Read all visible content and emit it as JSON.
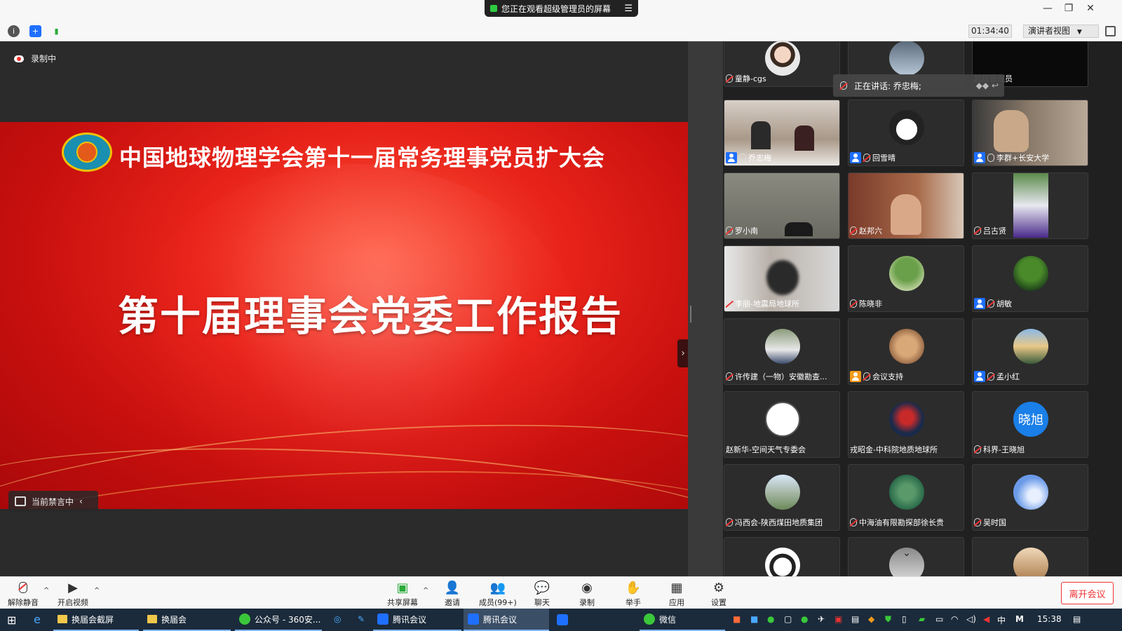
{
  "banner": {
    "text": "您正在观看超级管理员的屏幕",
    "menu_icon": "menu-icon"
  },
  "window_controls": [
    "minimize-icon",
    "restore-icon",
    "close-icon"
  ],
  "toolbar": {
    "icons": [
      "info-icon",
      "shield-icon",
      "signal-icon"
    ],
    "timer": "01:34:40",
    "view_mode": "演讲者视图",
    "fullscreen_icon": "fullscreen-icon"
  },
  "stage": {
    "recording_label": "录制中",
    "slide_title": "中国地球物理学会第十一届常务理事党员扩大会",
    "slide_main": "第十届理事会党委工作报告",
    "mute_status": "当前禁言中"
  },
  "speaking": {
    "text": "正在讲话: 乔忠梅;"
  },
  "participants": [
    {
      "name": "童静-cgs",
      "avatar": "child-photo",
      "host": false,
      "mic": "muted"
    },
    {
      "name": "",
      "avatar": "people-photo",
      "host": false,
      "mic": "none"
    },
    {
      "name": "超级管理员",
      "avatar": "dark-screen",
      "host": false,
      "mic": "none"
    },
    {
      "name": "乔忠梅",
      "avatar": "meeting-room-video",
      "host": true,
      "mic": "on"
    },
    {
      "name": "回雪晴",
      "avatar": "penguin-avatar",
      "host": true,
      "mic": "muted"
    },
    {
      "name": "李群+长安大学",
      "avatar": "man-video",
      "host": true,
      "mic": "on"
    },
    {
      "name": "罗小南",
      "avatar": "room-video",
      "host": false,
      "mic": "muted"
    },
    {
      "name": "赵邦六",
      "avatar": "office-video",
      "host": false,
      "mic": "muted"
    },
    {
      "name": "吕古贤",
      "avatar": "garden-video",
      "host": false,
      "mic": "muted"
    },
    {
      "name": "李丽-地震局地球所",
      "avatar": "blurred-video",
      "host": false,
      "mic": "muted"
    },
    {
      "name": "陈晓非",
      "avatar": "tree-photo",
      "host": false,
      "mic": "muted"
    },
    {
      "name": "胡敏",
      "avatar": "tree-photo-2",
      "host": true,
      "mic": "muted"
    },
    {
      "name": "许传建（一物）安徽勘查...",
      "avatar": "man-photo",
      "host": false,
      "mic": "muted"
    },
    {
      "name": "会议支持",
      "avatar": "dog-photo",
      "host": true,
      "mic": "muted",
      "badge": "orange"
    },
    {
      "name": "孟小红",
      "avatar": "lake-photo",
      "host": true,
      "mic": "muted"
    },
    {
      "name": "赵新华-空间天气专委会",
      "avatar": "tree-drawing",
      "host": false,
      "mic": "none"
    },
    {
      "name": "戎昭金-中科院地质地球所",
      "avatar": "art-photo",
      "host": false,
      "mic": "none"
    },
    {
      "name": "科界-王晓旭",
      "avatar": "text-avatar",
      "avatar_text": "晓旭",
      "host": false,
      "mic": "muted"
    },
    {
      "name": "冯西会-陕西煤田地质集团",
      "avatar": "statue-photo",
      "host": false,
      "mic": "muted"
    },
    {
      "name": "中海油有限勘探部徐长贵",
      "avatar": "river-photo",
      "host": false,
      "mic": "muted"
    },
    {
      "name": "吴时国",
      "avatar": "sky-photo",
      "host": false,
      "mic": "muted"
    },
    {
      "name": "",
      "avatar": "cartoon-girl",
      "host": false,
      "mic": "none"
    },
    {
      "name": "",
      "avatar": "scroll-down",
      "host": false,
      "mic": "none"
    },
    {
      "name": "",
      "avatar": "building-photo",
      "host": false,
      "mic": "none"
    }
  ],
  "bottombar": {
    "unmute": "解除静音",
    "video": "开启视频",
    "share": "共享屏幕",
    "invite": "邀请",
    "members": "成员(99+)",
    "chat": "聊天",
    "record": "录制",
    "raise_hand": "举手",
    "apps": "应用",
    "settings": "设置",
    "leave": "离开会议"
  },
  "taskbar": {
    "items": [
      "换届会截屏",
      "换届会",
      "公众号 - 360安...",
      "腾讯会议",
      "腾讯会议",
      "微信"
    ],
    "ime": "中",
    "time": "15:38"
  },
  "colors": {
    "accent_red": "#e33333",
    "host_blue": "#1f6fff",
    "slide_red": "#d8181a"
  }
}
